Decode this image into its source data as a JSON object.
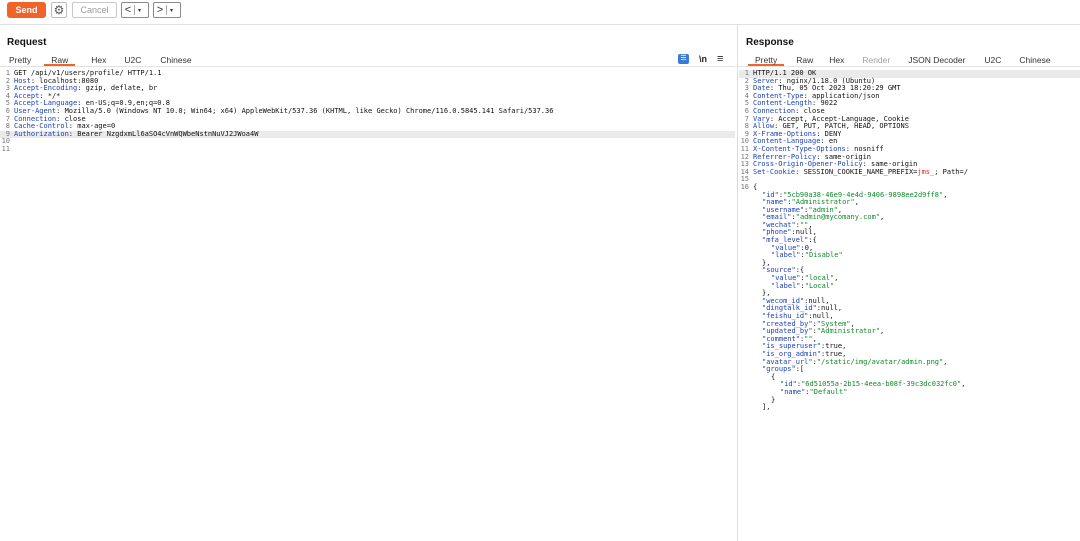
{
  "toolbar": {
    "send_label": "Send",
    "cancel_label": "Cancel",
    "back_symbol": "<",
    "forward_symbol": ">",
    "dropdown_symbol": "▾",
    "gear_symbol": "⚙"
  },
  "request": {
    "title": "Request",
    "tabs": [
      {
        "label": "Pretty"
      },
      {
        "label": "Raw"
      },
      {
        "label": "Hex"
      },
      {
        "label": "U2C"
      },
      {
        "label": "Chinese"
      }
    ],
    "active_tab": "Raw",
    "newline_label": "\\n",
    "menu_symbol": "≡",
    "lines": [
      {
        "n": "1",
        "name": "",
        "value": "GET /api/v1/users/profile/ HTTP/1.1"
      },
      {
        "n": "2",
        "name": "Host",
        "value": ": localhost:8080"
      },
      {
        "n": "3",
        "name": "Accept-Encoding",
        "value": ": gzip, deflate, br"
      },
      {
        "n": "4",
        "name": "Accept",
        "value": ": */*"
      },
      {
        "n": "5",
        "name": "Accept-Language",
        "value": ": en-US;q=0.9,en;q=0.8"
      },
      {
        "n": "6",
        "name": "User-Agent",
        "value": ": Mozilla/5.0 (Windows NT 10.0; Win64; x64) AppleWebKit/537.36 (KHTML, like Gecko) Chrome/116.0.5845.141 Safari/537.36"
      },
      {
        "n": "7",
        "name": "Connection",
        "value": ": close"
      },
      {
        "n": "8",
        "name": "Cache-Control",
        "value": ": max-age=0"
      },
      {
        "n": "9",
        "name": "Authorization",
        "value": ": Bearer NzgdxmLl6aSO4cVnWQWbeNstnNuVJ2JWoa4W"
      },
      {
        "n": "10",
        "name": "",
        "value": ""
      },
      {
        "n": "11",
        "name": "",
        "value": ""
      }
    ]
  },
  "response": {
    "title": "Response",
    "tabs": [
      {
        "label": "Pretty"
      },
      {
        "label": "Raw"
      },
      {
        "label": "Hex"
      },
      {
        "label": "Render"
      },
      {
        "label": "JSON Decoder"
      },
      {
        "label": "U2C"
      },
      {
        "label": "Chinese"
      }
    ],
    "active_tab": "Pretty",
    "header_lines": [
      {
        "n": "1",
        "name": "",
        "value": "HTTP/1.1 200 OK"
      },
      {
        "n": "2",
        "name": "Server",
        "value": ": nginx/1.18.0 (Ubuntu)"
      },
      {
        "n": "3",
        "name": "Date",
        "value": ": Thu, 05 Oct 2023 18:20:29 GMT"
      },
      {
        "n": "4",
        "name": "Content-Type",
        "value": ": application/json"
      },
      {
        "n": "5",
        "name": "Content-Length",
        "value": ": 9022"
      },
      {
        "n": "6",
        "name": "Connection",
        "value": ": close"
      },
      {
        "n": "7",
        "name": "Vary",
        "value": ": Accept, Accept-Language, Cookie"
      },
      {
        "n": "8",
        "name": "Allow",
        "value": ": GET, PUT, PATCH, HEAD, OPTIONS"
      },
      {
        "n": "9",
        "name": "X-Frame-Options",
        "value": ": DENY"
      },
      {
        "n": "10",
        "name": "Content-Language",
        "value": ": en"
      },
      {
        "n": "11",
        "name": "X-Content-Type-Options",
        "value": ": nosniff"
      },
      {
        "n": "12",
        "name": "Referrer-Policy",
        "value": ": same-origin"
      },
      {
        "n": "13",
        "name": "Cross-Origin-Opener-Policy",
        "value": ": same-origin"
      }
    ],
    "cookie_line": {
      "n": "14",
      "name": "Set-Cookie",
      "pre": ": SESSION_COOKIE_NAME_PREFIX=",
      "val": "jms_",
      "post": "; Path=/"
    },
    "blank_line_n": "15",
    "json_start_n": "16",
    "json_lines": [
      {
        "indent": 0,
        "parts": [
          {
            "t": "p",
            "v": "{"
          }
        ]
      },
      {
        "indent": 1,
        "parts": [
          {
            "t": "k",
            "v": "\"id\""
          },
          {
            "t": "p",
            "v": ":"
          },
          {
            "t": "s",
            "v": "\"5cb90a38-46e9-4e4d-9406-9898ee2d9ff8\""
          },
          {
            "t": "p",
            "v": ","
          }
        ]
      },
      {
        "indent": 1,
        "parts": [
          {
            "t": "k",
            "v": "\"name\""
          },
          {
            "t": "p",
            "v": ":"
          },
          {
            "t": "s",
            "v": "\"Administrator\""
          },
          {
            "t": "p",
            "v": ","
          }
        ]
      },
      {
        "indent": 1,
        "parts": [
          {
            "t": "k",
            "v": "\"username\""
          },
          {
            "t": "p",
            "v": ":"
          },
          {
            "t": "s",
            "v": "\"admin\""
          },
          {
            "t": "p",
            "v": ","
          }
        ]
      },
      {
        "indent": 1,
        "parts": [
          {
            "t": "k",
            "v": "\"email\""
          },
          {
            "t": "p",
            "v": ":"
          },
          {
            "t": "s",
            "v": "\"admin@mycomany.com\""
          },
          {
            "t": "p",
            "v": ","
          }
        ]
      },
      {
        "indent": 1,
        "parts": [
          {
            "t": "k",
            "v": "\"wechat\""
          },
          {
            "t": "p",
            "v": ":"
          },
          {
            "t": "s",
            "v": "\"\""
          },
          {
            "t": "p",
            "v": ","
          }
        ]
      },
      {
        "indent": 1,
        "parts": [
          {
            "t": "k",
            "v": "\"phone\""
          },
          {
            "t": "p",
            "v": ":null,"
          }
        ]
      },
      {
        "indent": 1,
        "parts": [
          {
            "t": "k",
            "v": "\"mfa_level\""
          },
          {
            "t": "p",
            "v": ":{"
          }
        ]
      },
      {
        "indent": 2,
        "parts": [
          {
            "t": "k",
            "v": "\"value\""
          },
          {
            "t": "p",
            "v": ":0,"
          }
        ]
      },
      {
        "indent": 2,
        "parts": [
          {
            "t": "k",
            "v": "\"label\""
          },
          {
            "t": "p",
            "v": ":"
          },
          {
            "t": "s",
            "v": "\"Disable\""
          }
        ]
      },
      {
        "indent": 1,
        "parts": [
          {
            "t": "p",
            "v": "},"
          }
        ]
      },
      {
        "indent": 1,
        "parts": [
          {
            "t": "k",
            "v": "\"source\""
          },
          {
            "t": "p",
            "v": ":{"
          }
        ]
      },
      {
        "indent": 2,
        "parts": [
          {
            "t": "k",
            "v": "\"value\""
          },
          {
            "t": "p",
            "v": ":"
          },
          {
            "t": "s",
            "v": "\"local\""
          },
          {
            "t": "p",
            "v": ","
          }
        ]
      },
      {
        "indent": 2,
        "parts": [
          {
            "t": "k",
            "v": "\"label\""
          },
          {
            "t": "p",
            "v": ":"
          },
          {
            "t": "s",
            "v": "\"Local\""
          }
        ]
      },
      {
        "indent": 1,
        "parts": [
          {
            "t": "p",
            "v": "},"
          }
        ]
      },
      {
        "indent": 1,
        "parts": [
          {
            "t": "k",
            "v": "\"wecom_id\""
          },
          {
            "t": "p",
            "v": ":null,"
          }
        ]
      },
      {
        "indent": 1,
        "parts": [
          {
            "t": "k",
            "v": "\"dingtalk_id\""
          },
          {
            "t": "p",
            "v": ":null,"
          }
        ]
      },
      {
        "indent": 1,
        "parts": [
          {
            "t": "k",
            "v": "\"feishu_id\""
          },
          {
            "t": "p",
            "v": ":null,"
          }
        ]
      },
      {
        "indent": 1,
        "parts": [
          {
            "t": "k",
            "v": "\"created_by\""
          },
          {
            "t": "p",
            "v": ":"
          },
          {
            "t": "s",
            "v": "\"System\""
          },
          {
            "t": "p",
            "v": ","
          }
        ]
      },
      {
        "indent": 1,
        "parts": [
          {
            "t": "k",
            "v": "\"updated_by\""
          },
          {
            "t": "p",
            "v": ":"
          },
          {
            "t": "s",
            "v": "\"Administrator\""
          },
          {
            "t": "p",
            "v": ","
          }
        ]
      },
      {
        "indent": 1,
        "parts": [
          {
            "t": "k",
            "v": "\"comment\""
          },
          {
            "t": "p",
            "v": ":"
          },
          {
            "t": "s",
            "v": "\"\""
          },
          {
            "t": "p",
            "v": ","
          }
        ]
      },
      {
        "indent": 1,
        "parts": [
          {
            "t": "k",
            "v": "\"is_superuser\""
          },
          {
            "t": "p",
            "v": ":true,"
          }
        ]
      },
      {
        "indent": 1,
        "parts": [
          {
            "t": "k",
            "v": "\"is_org_admin\""
          },
          {
            "t": "p",
            "v": ":true,"
          }
        ]
      },
      {
        "indent": 1,
        "parts": [
          {
            "t": "k",
            "v": "\"avatar_url\""
          },
          {
            "t": "p",
            "v": ":"
          },
          {
            "t": "s",
            "v": "\"/static/img/avatar/admin.png\""
          },
          {
            "t": "p",
            "v": ","
          }
        ]
      },
      {
        "indent": 1,
        "parts": [
          {
            "t": "k",
            "v": "\"groups\""
          },
          {
            "t": "p",
            "v": ":["
          }
        ]
      },
      {
        "indent": 2,
        "parts": [
          {
            "t": "p",
            "v": "{"
          }
        ]
      },
      {
        "indent": 3,
        "parts": [
          {
            "t": "k",
            "v": "\"id\""
          },
          {
            "t": "p",
            "v": ":"
          },
          {
            "t": "s",
            "v": "\"6d51055a-2b15-4eea-b08f-39c3dc032fc0\""
          },
          {
            "t": "p",
            "v": ","
          }
        ]
      },
      {
        "indent": 3,
        "parts": [
          {
            "t": "k",
            "v": "\"name\""
          },
          {
            "t": "p",
            "v": ":"
          },
          {
            "t": "s",
            "v": "\"Default\""
          }
        ]
      },
      {
        "indent": 2,
        "parts": [
          {
            "t": "p",
            "v": "}"
          }
        ]
      },
      {
        "indent": 1,
        "parts": [
          {
            "t": "p",
            "v": "],"
          }
        ]
      }
    ]
  },
  "colors": {
    "accent": "#f0642a",
    "header_name": "#1a3fb5",
    "json_string": "#0d8a28",
    "cookie_value": "#d9281d"
  }
}
